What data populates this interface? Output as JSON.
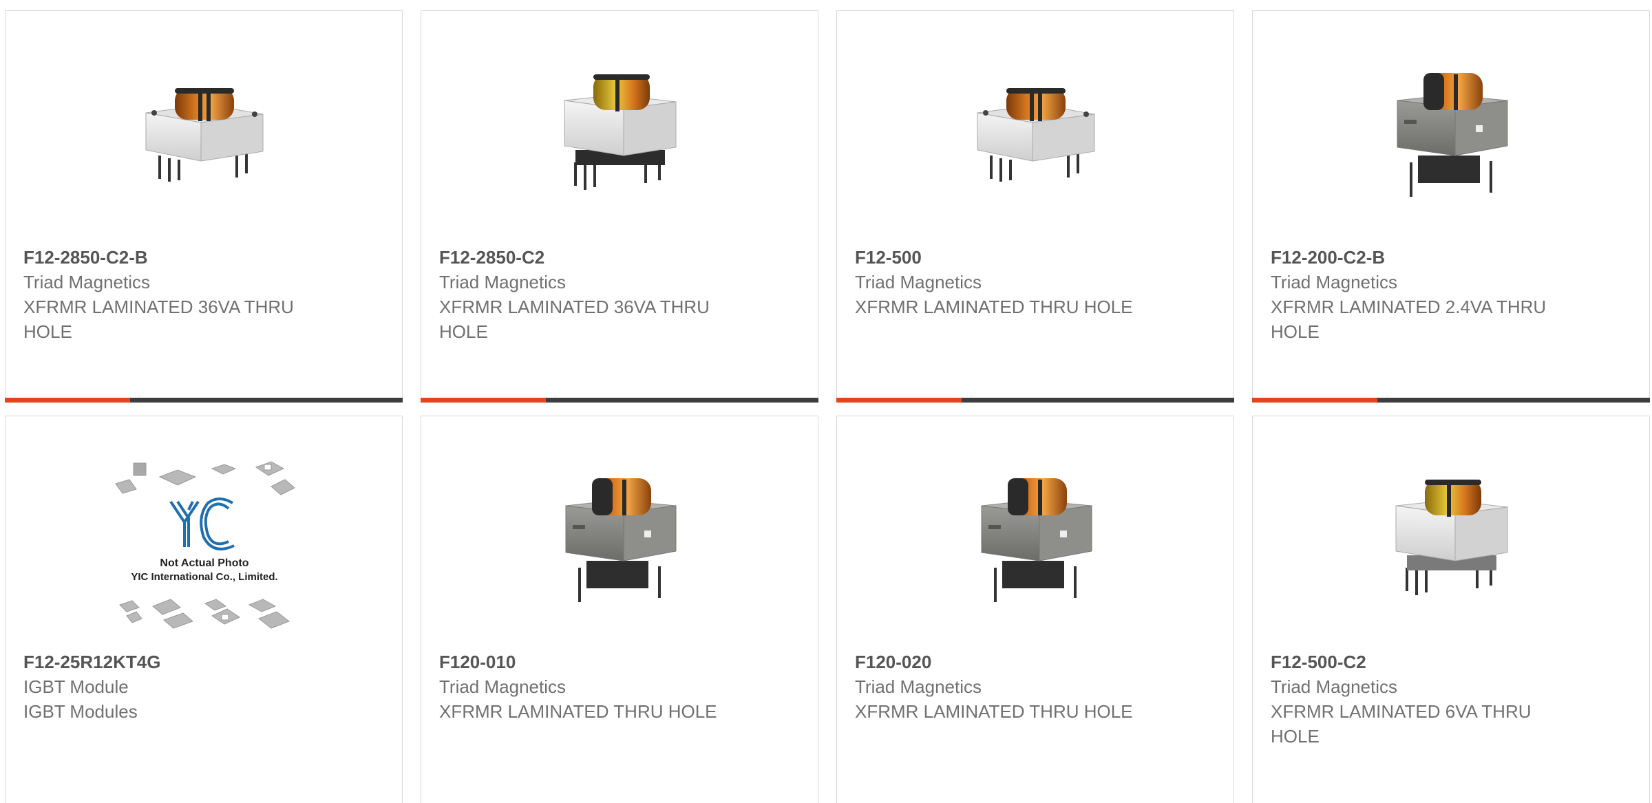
{
  "colors": {
    "accent": "#e8441c",
    "bar": "#3d3d3d",
    "border": "#d9d9d9",
    "part_text": "#555555",
    "body_text": "#707070"
  },
  "products": [
    {
      "part": "F12-2850-C2-B",
      "manufacturer": "Triad Magnetics",
      "description": "XFRMR LAMINATED 36VA THRU HOLE",
      "image": "transformer-white-icon"
    },
    {
      "part": "F12-2850-C2",
      "manufacturer": "Triad Magnetics",
      "description": "XFRMR LAMINATED 36VA THRU HOLE",
      "image": "transformer-white-yellow-icon"
    },
    {
      "part": "F12-500",
      "manufacturer": "Triad Magnetics",
      "description": "XFRMR LAMINATED THRU HOLE",
      "image": "transformer-white-icon"
    },
    {
      "part": "F12-200-C2-B",
      "manufacturer": "Triad Magnetics",
      "description": "XFRMR LAMINATED 2.4VA THRU HOLE",
      "image": "transformer-grey-icon"
    },
    {
      "part": "F12-25R12KT4G",
      "manufacturer": "IGBT Module",
      "description": "IGBT Modules",
      "image": "placeholder-logo-icon",
      "placeholder_logo": "YIC",
      "placeholder_line1": "Not Actual Photo",
      "placeholder_line2": "YIC International Co., Limited."
    },
    {
      "part": "F120-010",
      "manufacturer": "Triad Magnetics",
      "description": "XFRMR LAMINATED THRU HOLE",
      "image": "transformer-grey-icon"
    },
    {
      "part": "F120-020",
      "manufacturer": "Triad Magnetics",
      "description": "XFRMR LAMINATED THRU HOLE",
      "image": "transformer-grey-icon"
    },
    {
      "part": "F12-500-C2",
      "manufacturer": "Triad Magnetics",
      "description": "XFRMR LAMINATED 6VA THRU HOLE",
      "image": "transformer-white-yellow-icon"
    }
  ]
}
